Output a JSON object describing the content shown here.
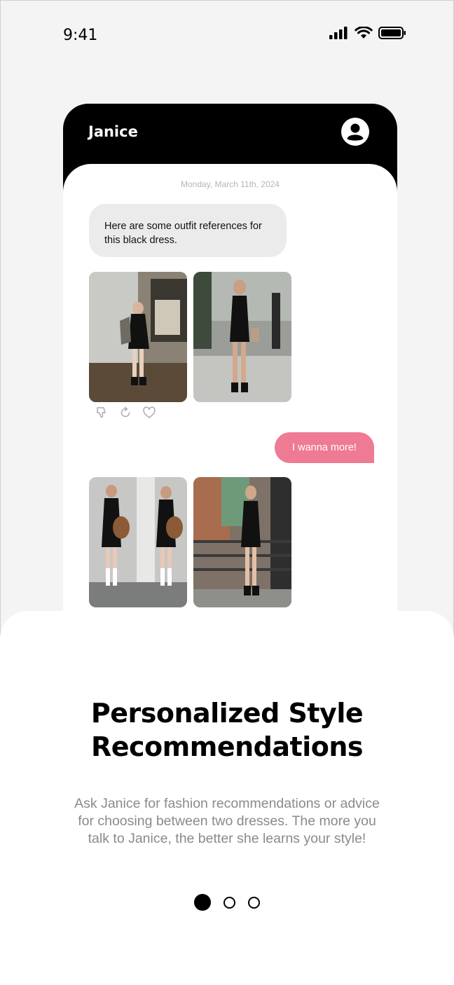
{
  "status_bar": {
    "time": "9:41",
    "icons": [
      "signal-icon",
      "wifi-icon",
      "battery-icon"
    ]
  },
  "chat": {
    "title": "Janice",
    "profile_icon": "profile-icon",
    "date": "Monday, March 11th, 2024",
    "bot_message": "Here are some outfit references for this black dress.",
    "user_message": "I wanna more!",
    "photos_group_1": [
      "outfit-photo",
      "outfit-photo"
    ],
    "photos_group_2": [
      "outfit-photo",
      "outfit-photo"
    ],
    "actions": [
      "thumbs-down-icon",
      "regenerate-icon",
      "heart-icon"
    ]
  },
  "onboarding": {
    "title_line1": "Personalized Style",
    "title_line2": "Recommendations",
    "desc_line1": "Ask Janice for fashion recommendations or advice",
    "desc_line2": "for choosing between two dresses. The more you",
    "desc_line3": "talk to Janice, the better she learns your style!",
    "page_indicator": {
      "current": 1,
      "total": 3
    }
  },
  "colors": {
    "user_bubble": "#ef7a93",
    "bot_bubble": "#ebebeb",
    "header": "#000000",
    "body_text_muted": "#8a8a8a"
  }
}
